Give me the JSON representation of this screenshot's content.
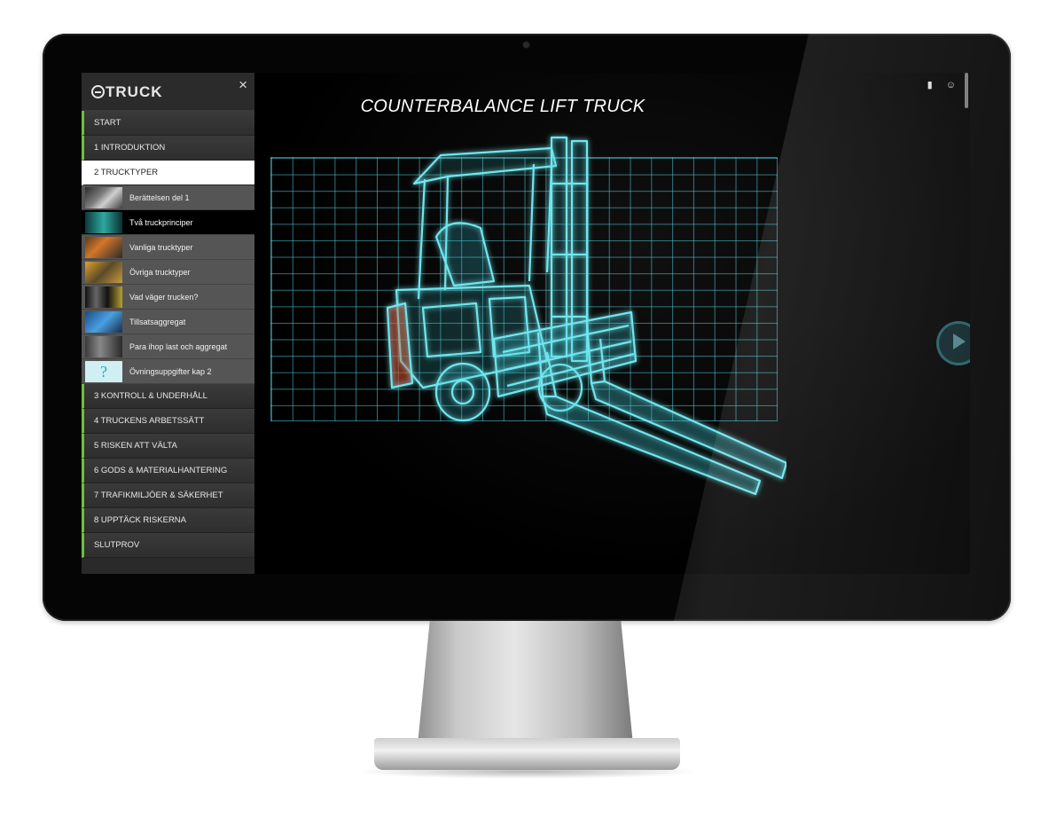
{
  "app": {
    "logo": "TRUCK",
    "close_icon": "×"
  },
  "sidebar": {
    "chapters_before": [
      {
        "label": "START"
      },
      {
        "label": "1 INTRODUKTION"
      }
    ],
    "active_chapter": {
      "label": "2 TRUCKTYPER"
    },
    "subitems": [
      {
        "label": "Berättelsen del 1",
        "icon": "thumbnail-scene"
      },
      {
        "label": "Två truckprinciper",
        "icon": "thumbnail-truck",
        "current": true
      },
      {
        "label": "Vanliga trucktyper",
        "icon": "thumbnail-orange-truck"
      },
      {
        "label": "Övriga trucktyper",
        "icon": "thumbnail-trucks"
      },
      {
        "label": "Vad väger trucken?",
        "icon": "thumbnail-weight"
      },
      {
        "label": "Tillsatsaggregat",
        "icon": "thumbnail-attachment"
      },
      {
        "label": "Para ihop last och aggregat",
        "icon": "thumbnail-loads"
      },
      {
        "label": "Övningsuppgifter kap 2",
        "icon": "question-mark",
        "glyph": "?"
      }
    ],
    "chapters_after": [
      {
        "label": "3 KONTROLL & UNDERHÅLL"
      },
      {
        "label": "4 TRUCKENS ARBETSSÄTT"
      },
      {
        "label": "5 RISKEN ATT VÄLTA"
      },
      {
        "label": "6 GODS & MATERIALHANTERING"
      },
      {
        "label": "7 TRAFIKMILJÖER & SÄKERHET"
      },
      {
        "label": "8 UPPTÄCK RISKERNA"
      },
      {
        "label": "SLUTPROV"
      }
    ]
  },
  "main": {
    "title": "COUNTERBALANCE LIFT TRUCK"
  },
  "colors": {
    "accent": "#6bc23a",
    "glow": "#50d2dc",
    "sidebar_bg": "#2a2a2a"
  }
}
